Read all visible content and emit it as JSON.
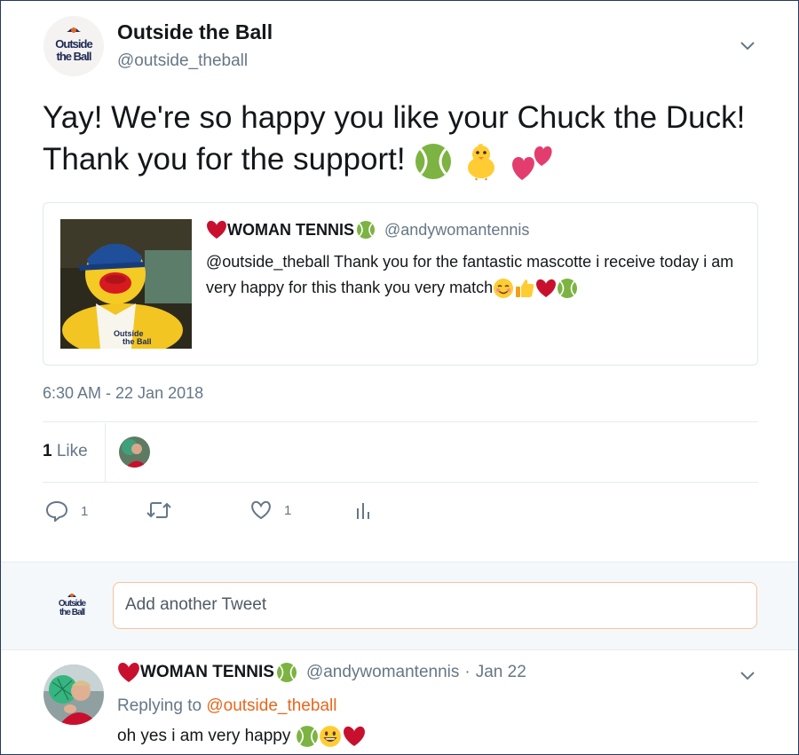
{
  "tweet": {
    "name": "Outside the Ball",
    "handle": "@outside_theball",
    "avatar_logo_line1": "Outside",
    "avatar_logo_line2": "the Ball",
    "text": "Yay! We're so happy you like your Chuck the Duck! Thank you for the support!",
    "emojis": [
      "tennis-ball",
      "chick",
      "two-hearts"
    ],
    "timestamp": "6:30 AM - 22 Jan 2018"
  },
  "quoted_tweet": {
    "name": "WOMAN TENNIS",
    "handle": "@andywomantennis",
    "text": "@outside_theball Thank you for the fantastic mascotte i receive today i am very happy for this thank you very match",
    "image_logo_line1": "Outside",
    "image_logo_line2": "the Ball"
  },
  "stats": {
    "likes_count": "1",
    "likes_label": "Like"
  },
  "actions": {
    "reply_count": "1",
    "retweet_count": "",
    "like_count": "1"
  },
  "compose": {
    "placeholder": "Add another Tweet",
    "logo_line1": "Outside",
    "logo_line2": "the Ball"
  },
  "reply": {
    "name": "WOMAN TENNIS",
    "handle": "@andywomantennis",
    "separator": "·",
    "date": "Jan 22",
    "replying_prefix": "Replying to",
    "replying_to": "@outside_theball",
    "text": "oh yes i am very happy"
  },
  "colors": {
    "accent": "#e8661c",
    "navy": "#1e2a55",
    "muted": "#657786",
    "heart": "#c8102e",
    "tennis": "#7cb342"
  }
}
